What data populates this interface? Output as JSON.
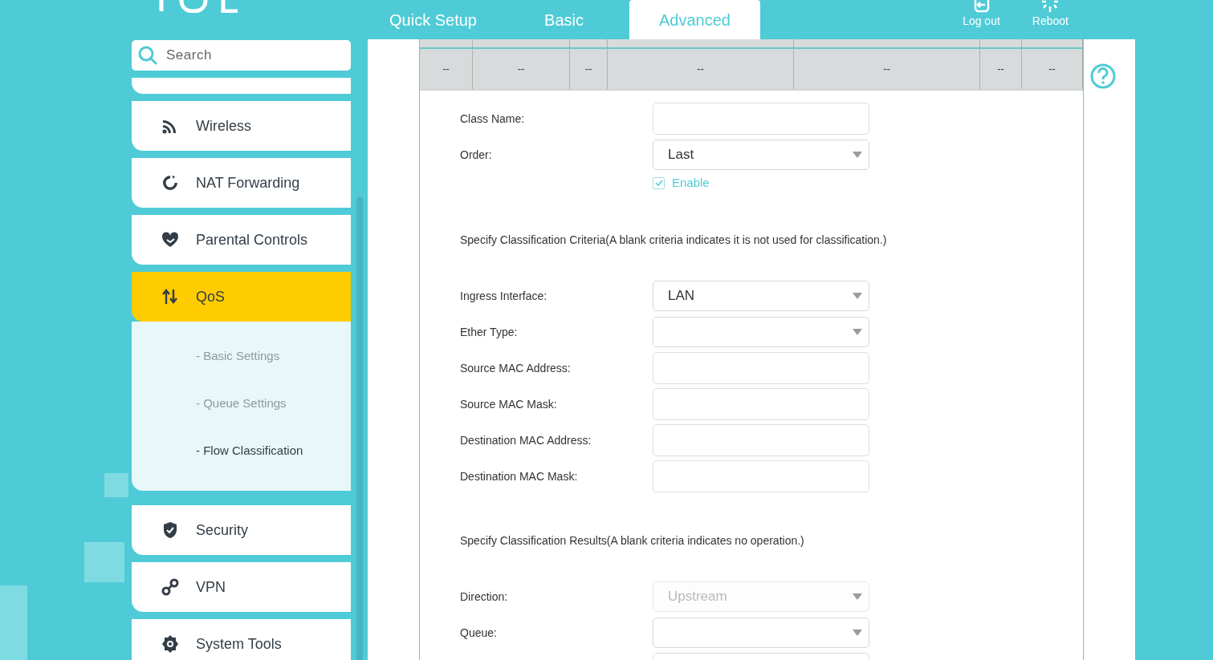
{
  "nav_tabs": [
    {
      "label": "Quick Setup",
      "selected": false
    },
    {
      "label": "Basic",
      "selected": false
    },
    {
      "label": "Advanced",
      "selected": true
    }
  ],
  "header_actions": [
    {
      "kind": "logout",
      "label": "Log out"
    },
    {
      "kind": "reboot",
      "label": "Reboot"
    }
  ],
  "search": {
    "placeholder": "Search"
  },
  "sidebar": {
    "items": [
      {
        "kind": "blank"
      },
      {
        "kind": "wireless",
        "label": "Wireless",
        "selected": false
      },
      {
        "kind": "nat",
        "label": "NAT Forwarding",
        "selected": false
      },
      {
        "kind": "parental",
        "label": "Parental Controls",
        "selected": false
      },
      {
        "kind": "qos",
        "label": "QoS",
        "selected": true,
        "children": [
          {
            "label": "- Basic Settings",
            "selected": false
          },
          {
            "label": "- Queue Settings",
            "selected": false
          },
          {
            "label": "- Flow Classification",
            "selected": true
          }
        ]
      },
      {
        "kind": "security",
        "label": "Security",
        "selected": false
      },
      {
        "kind": "vpn",
        "label": "VPN",
        "selected": false
      },
      {
        "kind": "tools",
        "label": "System Tools",
        "selected": false
      }
    ]
  },
  "table": {
    "rows": [
      [
        "--",
        "--",
        "--",
        "--",
        "--",
        "--",
        "--"
      ]
    ]
  },
  "form": [
    {
      "kind": "text",
      "label": "Class Name:"
    },
    {
      "kind": "select",
      "label": "Order:",
      "value": "Last",
      "disabled": false
    },
    {
      "kind": "checkbox",
      "label": "Enable",
      "checked": true
    },
    {
      "kind": "note",
      "label": "Specify Classification Criteria(A blank criteria indicates it is not used for classification.)"
    },
    {
      "kind": "select",
      "label": "Ingress Interface:",
      "value": "LAN",
      "disabled": false
    },
    {
      "kind": "select",
      "label": "Ether Type:",
      "disabled": false
    },
    {
      "kind": "text",
      "label": "Source MAC Address:"
    },
    {
      "kind": "text",
      "label": "Source MAC Mask:"
    },
    {
      "kind": "text",
      "label": "Destination MAC Address:"
    },
    {
      "kind": "text",
      "label": "Destination MAC Mask:"
    },
    {
      "kind": "note",
      "label": "Specify Classification Results(A blank criteria indicates no operation.)"
    },
    {
      "kind": "select",
      "label": "Direction:",
      "value": "Upstream",
      "disabled": true
    },
    {
      "kind": "select",
      "label": "Queue:",
      "disabled": false
    },
    {
      "kind": "text"
    }
  ]
}
